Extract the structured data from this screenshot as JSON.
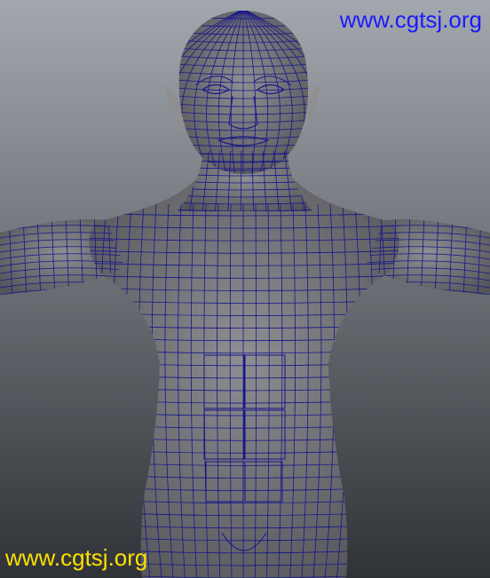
{
  "viewport": {
    "subject": "wireframe-humanoid-model",
    "background_top": "#a3a8ae",
    "background_bottom": "#2f3338",
    "mesh_fill": "#8f8f92",
    "mesh_shadow": "#55555a",
    "wire_color": "#16168a"
  },
  "watermarks": {
    "top_right": "www.cgtsj.org",
    "bottom_left": "www.cgtsj.org",
    "top_color": "#1a1aff",
    "bottom_color": "#ffe000"
  }
}
